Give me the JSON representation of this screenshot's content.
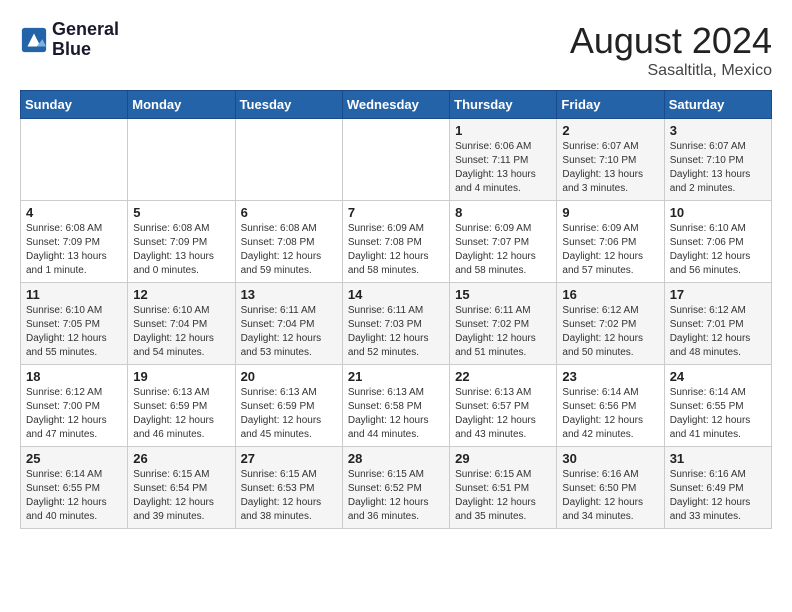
{
  "header": {
    "logo_line1": "General",
    "logo_line2": "Blue",
    "month": "August 2024",
    "location": "Sasaltitla, Mexico"
  },
  "days_of_week": [
    "Sunday",
    "Monday",
    "Tuesday",
    "Wednesday",
    "Thursday",
    "Friday",
    "Saturday"
  ],
  "weeks": [
    [
      {
        "day": "",
        "content": ""
      },
      {
        "day": "",
        "content": ""
      },
      {
        "day": "",
        "content": ""
      },
      {
        "day": "",
        "content": ""
      },
      {
        "day": "1",
        "content": "Sunrise: 6:06 AM\nSunset: 7:11 PM\nDaylight: 13 hours\nand 4 minutes."
      },
      {
        "day": "2",
        "content": "Sunrise: 6:07 AM\nSunset: 7:10 PM\nDaylight: 13 hours\nand 3 minutes."
      },
      {
        "day": "3",
        "content": "Sunrise: 6:07 AM\nSunset: 7:10 PM\nDaylight: 13 hours\nand 2 minutes."
      }
    ],
    [
      {
        "day": "4",
        "content": "Sunrise: 6:08 AM\nSunset: 7:09 PM\nDaylight: 13 hours\nand 1 minute."
      },
      {
        "day": "5",
        "content": "Sunrise: 6:08 AM\nSunset: 7:09 PM\nDaylight: 13 hours\nand 0 minutes."
      },
      {
        "day": "6",
        "content": "Sunrise: 6:08 AM\nSunset: 7:08 PM\nDaylight: 12 hours\nand 59 minutes."
      },
      {
        "day": "7",
        "content": "Sunrise: 6:09 AM\nSunset: 7:08 PM\nDaylight: 12 hours\nand 58 minutes."
      },
      {
        "day": "8",
        "content": "Sunrise: 6:09 AM\nSunset: 7:07 PM\nDaylight: 12 hours\nand 58 minutes."
      },
      {
        "day": "9",
        "content": "Sunrise: 6:09 AM\nSunset: 7:06 PM\nDaylight: 12 hours\nand 57 minutes."
      },
      {
        "day": "10",
        "content": "Sunrise: 6:10 AM\nSunset: 7:06 PM\nDaylight: 12 hours\nand 56 minutes."
      }
    ],
    [
      {
        "day": "11",
        "content": "Sunrise: 6:10 AM\nSunset: 7:05 PM\nDaylight: 12 hours\nand 55 minutes."
      },
      {
        "day": "12",
        "content": "Sunrise: 6:10 AM\nSunset: 7:04 PM\nDaylight: 12 hours\nand 54 minutes."
      },
      {
        "day": "13",
        "content": "Sunrise: 6:11 AM\nSunset: 7:04 PM\nDaylight: 12 hours\nand 53 minutes."
      },
      {
        "day": "14",
        "content": "Sunrise: 6:11 AM\nSunset: 7:03 PM\nDaylight: 12 hours\nand 52 minutes."
      },
      {
        "day": "15",
        "content": "Sunrise: 6:11 AM\nSunset: 7:02 PM\nDaylight: 12 hours\nand 51 minutes."
      },
      {
        "day": "16",
        "content": "Sunrise: 6:12 AM\nSunset: 7:02 PM\nDaylight: 12 hours\nand 50 minutes."
      },
      {
        "day": "17",
        "content": "Sunrise: 6:12 AM\nSunset: 7:01 PM\nDaylight: 12 hours\nand 48 minutes."
      }
    ],
    [
      {
        "day": "18",
        "content": "Sunrise: 6:12 AM\nSunset: 7:00 PM\nDaylight: 12 hours\nand 47 minutes."
      },
      {
        "day": "19",
        "content": "Sunrise: 6:13 AM\nSunset: 6:59 PM\nDaylight: 12 hours\nand 46 minutes."
      },
      {
        "day": "20",
        "content": "Sunrise: 6:13 AM\nSunset: 6:59 PM\nDaylight: 12 hours\nand 45 minutes."
      },
      {
        "day": "21",
        "content": "Sunrise: 6:13 AM\nSunset: 6:58 PM\nDaylight: 12 hours\nand 44 minutes."
      },
      {
        "day": "22",
        "content": "Sunrise: 6:13 AM\nSunset: 6:57 PM\nDaylight: 12 hours\nand 43 minutes."
      },
      {
        "day": "23",
        "content": "Sunrise: 6:14 AM\nSunset: 6:56 PM\nDaylight: 12 hours\nand 42 minutes."
      },
      {
        "day": "24",
        "content": "Sunrise: 6:14 AM\nSunset: 6:55 PM\nDaylight: 12 hours\nand 41 minutes."
      }
    ],
    [
      {
        "day": "25",
        "content": "Sunrise: 6:14 AM\nSunset: 6:55 PM\nDaylight: 12 hours\nand 40 minutes."
      },
      {
        "day": "26",
        "content": "Sunrise: 6:15 AM\nSunset: 6:54 PM\nDaylight: 12 hours\nand 39 minutes."
      },
      {
        "day": "27",
        "content": "Sunrise: 6:15 AM\nSunset: 6:53 PM\nDaylight: 12 hours\nand 38 minutes."
      },
      {
        "day": "28",
        "content": "Sunrise: 6:15 AM\nSunset: 6:52 PM\nDaylight: 12 hours\nand 36 minutes."
      },
      {
        "day": "29",
        "content": "Sunrise: 6:15 AM\nSunset: 6:51 PM\nDaylight: 12 hours\nand 35 minutes."
      },
      {
        "day": "30",
        "content": "Sunrise: 6:16 AM\nSunset: 6:50 PM\nDaylight: 12 hours\nand 34 minutes."
      },
      {
        "day": "31",
        "content": "Sunrise: 6:16 AM\nSunset: 6:49 PM\nDaylight: 12 hours\nand 33 minutes."
      }
    ]
  ]
}
